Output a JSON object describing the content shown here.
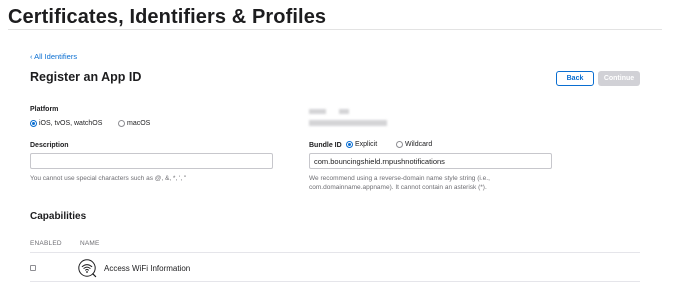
{
  "header": {
    "title": "Certificates, Identifiers & Profiles"
  },
  "nav": {
    "back_link": "‹ All Identifiers"
  },
  "form": {
    "title": "Register an App ID",
    "back_button": "Back",
    "continue_button": "Continue",
    "platform": {
      "label": "Platform",
      "options": [
        {
          "label": "iOS, tvOS, watchOS",
          "selected": true
        },
        {
          "label": "macOS",
          "selected": false
        }
      ]
    },
    "description": {
      "label": "Description",
      "value": "",
      "help": "You cannot use special characters such as @, &, *, ', \""
    },
    "bundle_id": {
      "label": "Bundle ID",
      "options": [
        {
          "label": "Explicit",
          "selected": true
        },
        {
          "label": "Wildcard",
          "selected": false
        }
      ],
      "value": "com.bouncingshield.rnpushnotifications",
      "help_line1": "We recommend using a reverse-domain name style string (i.e.,",
      "help_line2": "com.domainname.appname). It cannot contain an asterisk (*)."
    }
  },
  "capabilities": {
    "title": "Capabilities",
    "columns": {
      "enabled": "ENABLED",
      "name": "NAME"
    },
    "rows": [
      {
        "name": "Access WiFi Information",
        "enabled": false,
        "icon": "wifi-info-icon"
      }
    ]
  },
  "colors": {
    "accent": "#0a6ed1",
    "disabled_button": "#d1d1d6",
    "text": "#1d1d1f",
    "muted": "#6e6e73"
  }
}
